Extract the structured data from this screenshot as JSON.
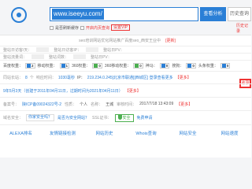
{
  "search": {
    "value": "www.iseeyu.com/",
    "button": "查看分析",
    "button2": "历史查询",
    "history_label": "历史记录"
  },
  "options": {
    "cache": "是否刷新缓存",
    "new_label": "开启内页查询",
    "tag": "设置VIP"
  },
  "title": "seo培训网站优化网站推广百度seo_西安王业中",
  "title_tag": "[更新]",
  "rows": {
    "r1": {
      "a": "整站日访客/天：",
      "b": "整站日访客IP：",
      "c": "整站日PV："
    },
    "r2": {
      "a": "整站流量词：",
      "b": "整站词数：",
      "c": "整站日PV："
    },
    "weight": {
      "baidu_label": "百度权重：",
      "baidu": "2",
      "mobile_label": "移动权重：",
      "mobile": "1",
      "three60_label": "360权重：",
      "three60": "0",
      "three60m_label": "360移动权重：",
      "three60m": "0",
      "shenma_label": "神马：",
      "shenma": "0",
      "sogou_label": "搜狗：",
      "sogou": "0",
      "toutiao_label": "头条权重：",
      "toutiao": "0",
      "redbox": "收录"
    },
    "site": {
      "label": "同站长站：",
      "v1": "8",
      "label2": "个",
      "label3": "响应时间：",
      "v2": "1030毫秒",
      "label4": "IP：",
      "ip": "219.234.0.245[北京市联通][西城区] 登录查看更多",
      "v3": "【更多】"
    },
    "age": {
      "text": "9年5月3天（创建于2011年04月11日，过期时间为2021年04月11日）",
      "more": "【更多】"
    },
    "beian": {
      "label": "备案号：",
      "num": "陕ICP备09024322号-2",
      "type_label": "性质：",
      "type": "个人",
      "name_label": "名称：",
      "name": "王城",
      "date_label": "审核时间：",
      "date": "2017/7/18 13:43:09",
      "more": "【更多】"
    },
    "safe": {
      "label": "域名安全：",
      "q": "你家安全吗？",
      "hint": "是否为安全网站？",
      "ssl": "SSL证书：",
      "ssl_val": "安全 ",
      "vip": "免费申请"
    }
  },
  "tools": [
    "ALEXA排名",
    "友情链接检测",
    "网站历史",
    "Whois查询",
    "网站安全",
    "网站速度"
  ]
}
